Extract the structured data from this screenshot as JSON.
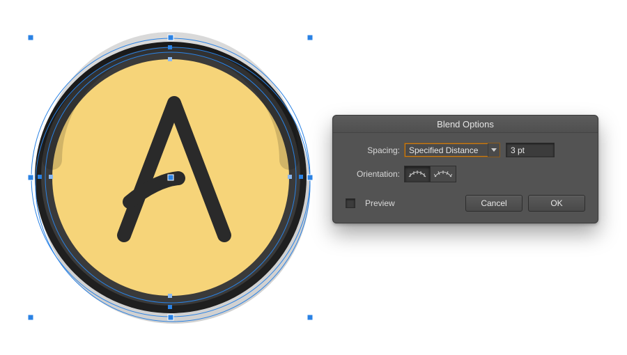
{
  "dialog": {
    "title": "Blend Options",
    "spacing_label": "Spacing:",
    "spacing_mode": "Specified Distance",
    "spacing_value": "3 pt",
    "orientation_label": "Orientation:",
    "preview_label": "Preview",
    "cancel_label": "Cancel",
    "ok_label": "OK"
  },
  "artwork": {
    "description": "Selected circular coin badge with letter A, on white canvas",
    "fill_color": "#f6d479",
    "ring_color": "#2a2a2a",
    "selection_color": "#2a82e4"
  }
}
